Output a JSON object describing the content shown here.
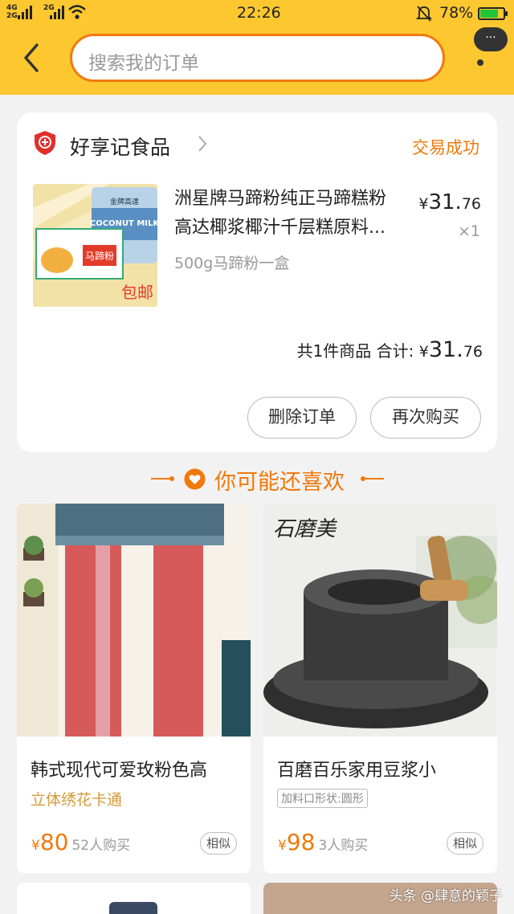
{
  "status_bar": {
    "network_1": "4G",
    "network_2": "2G",
    "network_3": "2G",
    "time": "22:26",
    "battery_percent": "78%",
    "battery_level": 0.78
  },
  "header": {
    "search_placeholder": "搜索我的订单",
    "more_label": "···"
  },
  "order": {
    "store_name": "好享记食品",
    "status": "交易成功",
    "product_title_line1": "洲星牌马蹄粉纯正马蹄糕粉",
    "product_title_line2": "高达椰浆椰汁千层糕原料...",
    "product_spec": "500g马蹄粉一盒",
    "price_currency": "¥",
    "price_int": "31.",
    "price_dec": "76",
    "quantity": "×1",
    "summary_label": "共1件商品 合计:",
    "total_currency": "¥",
    "total_int": "31.",
    "total_dec": "76",
    "delete_button": "删除订单",
    "rebuy_button": "再次购买",
    "thumb_badge_text": "包邮",
    "thumb_can_text": "COCONUT MILK",
    "thumb_brand_text": "金牌高達",
    "thumb_pack_text": "马蹄粉"
  },
  "recommend": {
    "heading": "你可能还喜欢",
    "items": [
      {
        "name": "韩式现代可爱玫粉色高",
        "subtitle": "立体绣花卡通",
        "currency": "¥",
        "price": "80",
        "buyers": "52人购买",
        "similar": "相似"
      },
      {
        "name": "百磨百乐家用豆浆小",
        "tag": "加料口形状:圆形",
        "currency": "¥",
        "price": "98",
        "buyers": "3人购买",
        "similar": "相似",
        "image_logo_text": "石磨美"
      }
    ]
  },
  "watermark": "头条 @肆意的颖子",
  "colors": {
    "topbar": "#fcc72f",
    "accent": "#f0790c",
    "search_border": "#f07a12",
    "store_badge": "#e0302a"
  },
  "icons": {
    "back": "chevron-left-icon",
    "store": "shield-icon",
    "heart": "heart-icon",
    "more": "more-dots-icon"
  }
}
